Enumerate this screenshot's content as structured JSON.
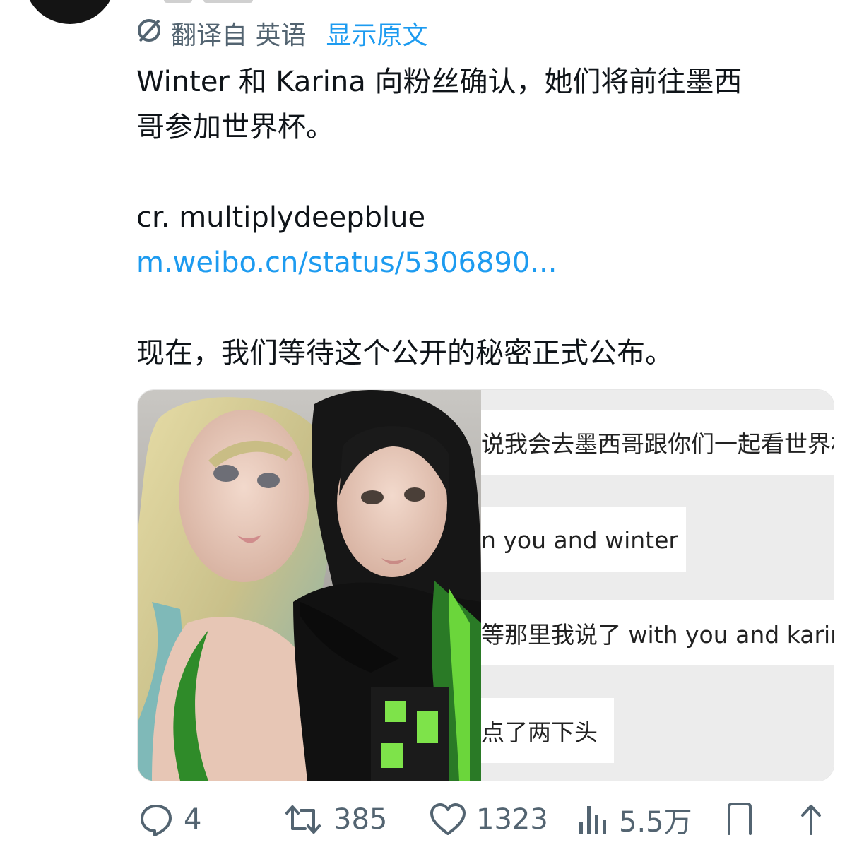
{
  "translation": {
    "label": "翻译自 英语",
    "show_original": "显示原文",
    "icon": "translate-icon"
  },
  "tweet": {
    "line1": "Winter 和 Karina 向粉丝确认，她们将前往墨西",
    "line2": "哥参加世界杯。",
    "credit": "cr. multiplydeepblue",
    "link": "m.weibo.cn/status/5306890...",
    "closing": "现在，我们等待这个公开的秘密正式公布。"
  },
  "media": {
    "chat": {
      "line1": "说我会去墨西哥跟你们一起看世界杯",
      "line2": "n you and winter",
      "line3": "等那里我说了 with you and karina",
      "line4": "点了两下头"
    }
  },
  "actions": {
    "replies": "4",
    "retweets": "385",
    "likes": "1323",
    "views": "5.5万"
  },
  "colors": {
    "link": "#1d9bf0",
    "muted": "#536471",
    "text": "#0f1419"
  }
}
